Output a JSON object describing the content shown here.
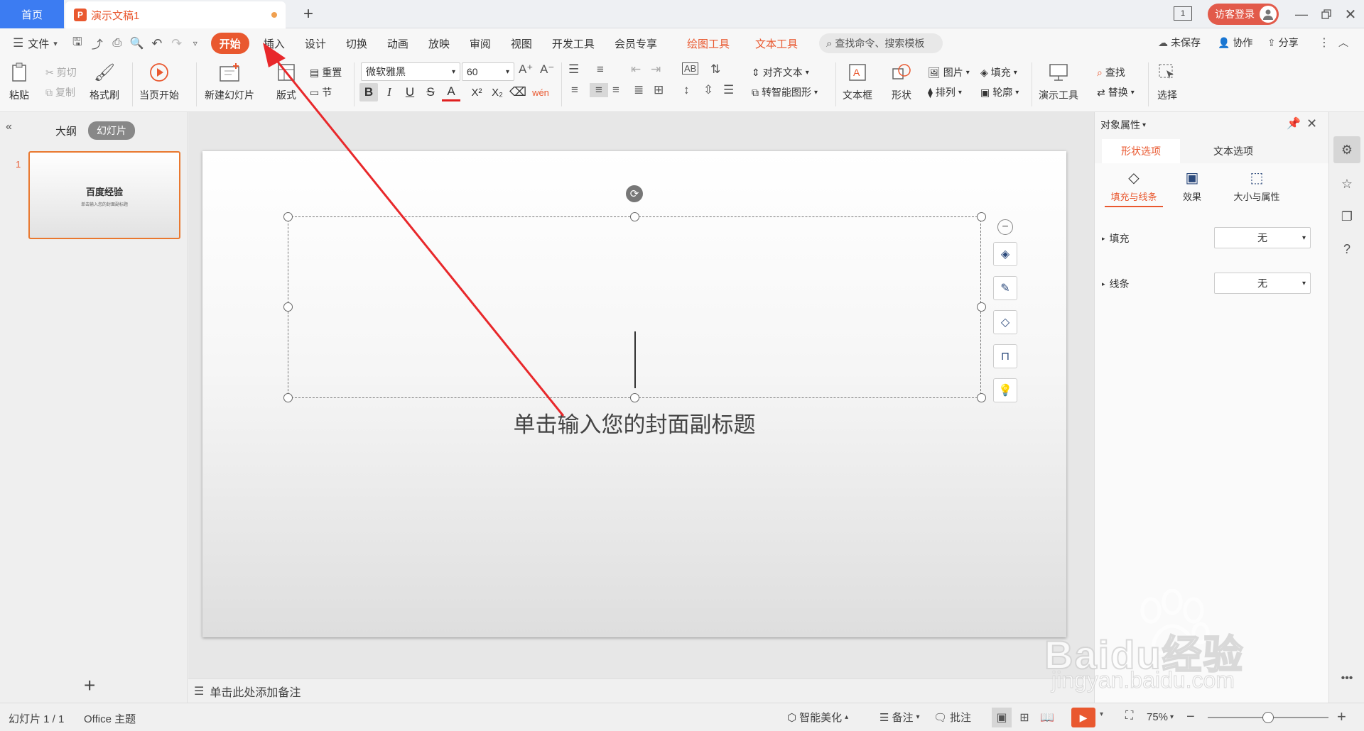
{
  "tabs": {
    "home": "首页",
    "doc_name": "演示文稿1",
    "new_tab": "+"
  },
  "titlebar": {
    "login": "访客登录",
    "page_badge": "1"
  },
  "menu": {
    "file": "文件",
    "items": [
      "开始",
      "插入",
      "设计",
      "切换",
      "动画",
      "放映",
      "审阅",
      "视图",
      "开发工具",
      "会员专享"
    ],
    "drawing_tools": "绘图工具",
    "text_tools": "文本工具",
    "search_placeholder": "查找命令、搜索模板",
    "unsaved": "未保存",
    "collab": "协作",
    "share": "分享"
  },
  "ribbon": {
    "paste": "粘贴",
    "cut": "剪切",
    "copy": "复制",
    "format_painter": "格式刷",
    "from_current": "当页开始",
    "new_slide": "新建幻灯片",
    "layout": "版式",
    "reset": "重置",
    "section": "节",
    "font_name": "微软雅黑",
    "font_size": "60",
    "align_text": "对齐文本",
    "smart_art": "转智能图形",
    "textbox": "文本框",
    "shape": "形状",
    "picture": "图片",
    "fill": "填充",
    "arrange": "排列",
    "outline": "轮廓",
    "present_tools": "演示工具",
    "find": "查找",
    "replace": "替换",
    "select": "选择"
  },
  "left": {
    "outline_tab": "大纲",
    "slides_tab": "幻灯片",
    "slide_number": "1",
    "thumb_title": "百度经验",
    "thumb_sub": "单击输入您的封面副标题"
  },
  "slide": {
    "subtitle": "单击输入您的封面副标题"
  },
  "notes": {
    "placeholder": "单击此处添加备注"
  },
  "right_panel": {
    "title": "对象属性",
    "tab_shape": "形状选项",
    "tab_text": "文本选项",
    "sub_fill_line": "填充与线条",
    "sub_effect": "效果",
    "sub_size": "大小与属性",
    "fill_label": "填充",
    "fill_value": "无",
    "line_label": "线条",
    "line_value": "无"
  },
  "status": {
    "slide_count": "幻灯片 1 / 1",
    "theme": "Office 主题",
    "beautify": "智能美化",
    "notes": "备注",
    "comments": "批注",
    "zoom": "75%",
    "zoom_level": 0.5
  },
  "watermark": {
    "brand": "Baidu经验",
    "url": "jingyan.baidu.com"
  },
  "colors": {
    "accent": "#e9582f",
    "home_tab": "#3c7cf2",
    "arrow": "#e8282b"
  }
}
